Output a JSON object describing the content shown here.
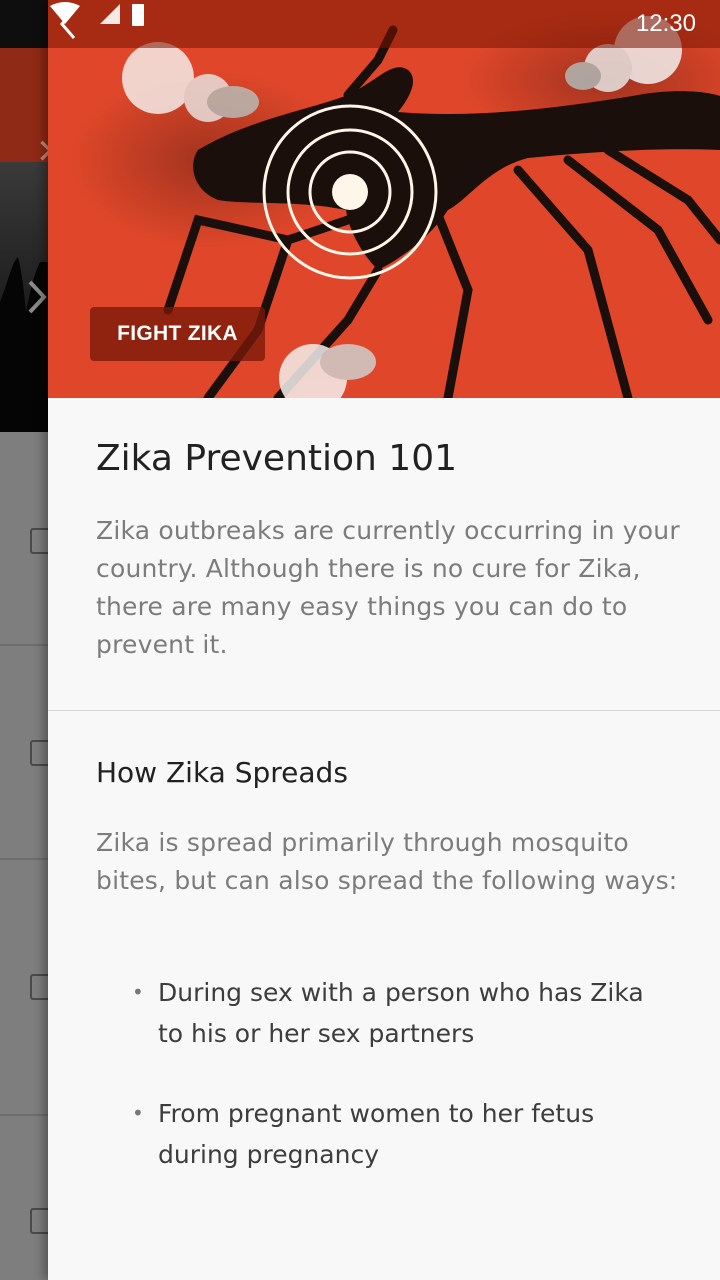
{
  "status_bar": {
    "time": "12:30"
  },
  "background_screen": {
    "close_icon": "close-icon",
    "list_row_count": 4
  },
  "hero": {
    "back_icon": "chevron-left-icon",
    "tag_label": "FIGHT ZIKA",
    "colors": {
      "accent": "#e0472a",
      "tag_bg": "#7a1a08"
    }
  },
  "article": {
    "title": "Zika Prevention 101",
    "intro": "Zika outbreaks are currently occurring in your country. Although there is no cure for Zika, there are many easy things you can do to prevent it.",
    "section_title": "How Zika Spreads",
    "section_text": "Zika is spread primarily through mosquito bites, but can also spread the following ways:",
    "bullets": [
      "During sex with a person who has Zika to his or her sex partners",
      "From pregnant women to her fetus during pregnancy"
    ]
  }
}
